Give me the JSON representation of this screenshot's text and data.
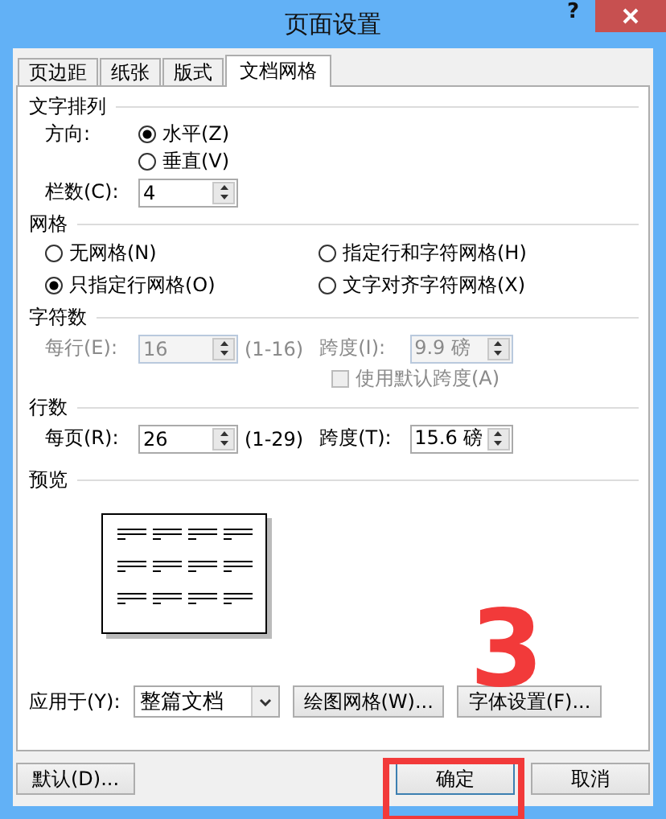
{
  "window": {
    "title": "页面设置",
    "help": "?"
  },
  "tabs": [
    {
      "label": "页边距",
      "selected": false
    },
    {
      "label": "纸张",
      "selected": false
    },
    {
      "label": "版式",
      "selected": false
    },
    {
      "label": "文档网格",
      "selected": true
    }
  ],
  "text_direction": {
    "heading": "文字排列",
    "label": "方向:",
    "options": [
      {
        "label": "水平(Z)",
        "selected": true
      },
      {
        "label": "垂直(V)",
        "selected": false
      }
    ],
    "columns": {
      "label": "栏数(C):",
      "value": "4"
    }
  },
  "grid": {
    "heading": "网格",
    "options": [
      {
        "label": "无网格(N)",
        "selected": false
      },
      {
        "label": "指定行和字符网格(H)",
        "selected": false
      },
      {
        "label": "只指定行网格(O)",
        "selected": true
      },
      {
        "label": "文字对齐字符网格(X)",
        "selected": false
      }
    ]
  },
  "characters": {
    "heading": "字符数",
    "disabled": true,
    "per_line": {
      "label": "每行(E):",
      "value": "16",
      "range": "(1-16)"
    },
    "pitch": {
      "label": "跨度(I):",
      "value": "9.9 磅"
    },
    "default_pitch": {
      "label": "使用默认跨度(A)",
      "checked": false
    }
  },
  "lines": {
    "heading": "行数",
    "disabled": false,
    "per_page": {
      "label": "每页(R):",
      "value": "26",
      "range": "(1-29)"
    },
    "pitch": {
      "label": "跨度(T):",
      "value": "15.6 磅"
    }
  },
  "preview": {
    "heading": "预览"
  },
  "apply_to": {
    "label": "应用于(Y):",
    "value": "整篇文档"
  },
  "buttons": [
    {
      "label": "绘图网格(W)..."
    },
    {
      "label": "字体设置(F)..."
    }
  ],
  "footer": {
    "default_button": "默认(D)...",
    "ok_button": "确定",
    "cancel_button": "取消"
  },
  "annotation": {
    "text": "3"
  }
}
